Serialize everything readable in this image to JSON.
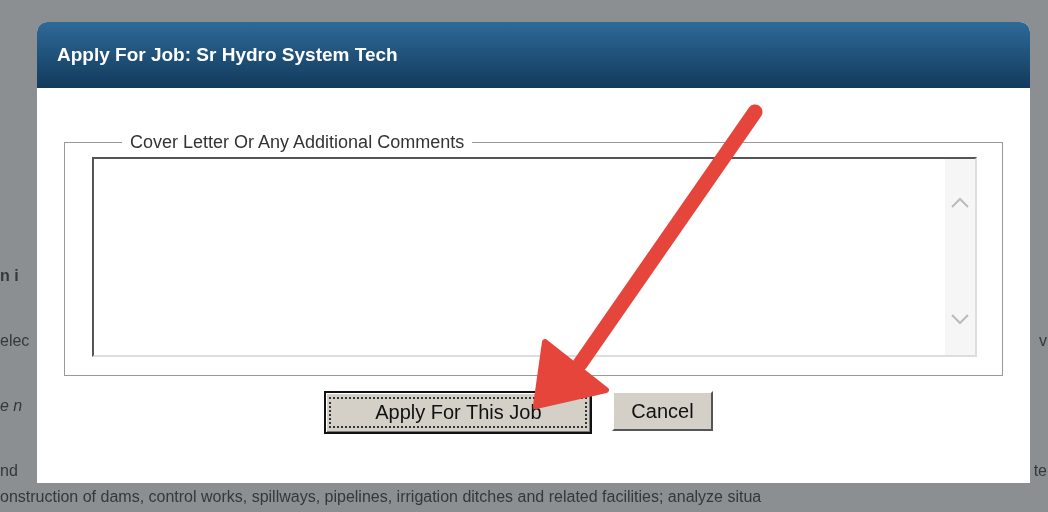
{
  "background_page": {
    "lines": [
      {
        "left": "n i",
        "bold": true,
        "italic": false
      },
      {
        "left": "elec",
        "bold": false,
        "italic": false,
        "right": "v"
      },
      {
        "left": "e n",
        "bold": false,
        "italic": true
      },
      {
        "left": "nd",
        "bold": false,
        "italic": false,
        "right": "te"
      },
      {
        "left": "onstruction of dams, control works, spillways, pipelines, irrigation ditches and related facilities; analyze situa",
        "bold": false,
        "italic": false
      }
    ]
  },
  "dialog": {
    "title": "Apply For Job: Sr Hydro System Tech",
    "fieldset_legend": "Cover Letter Or Any Additional Comments",
    "buttons": [
      {
        "label": "Apply For This Job",
        "focused": true
      },
      {
        "label": "Cancel",
        "focused": false
      }
    ]
  }
}
